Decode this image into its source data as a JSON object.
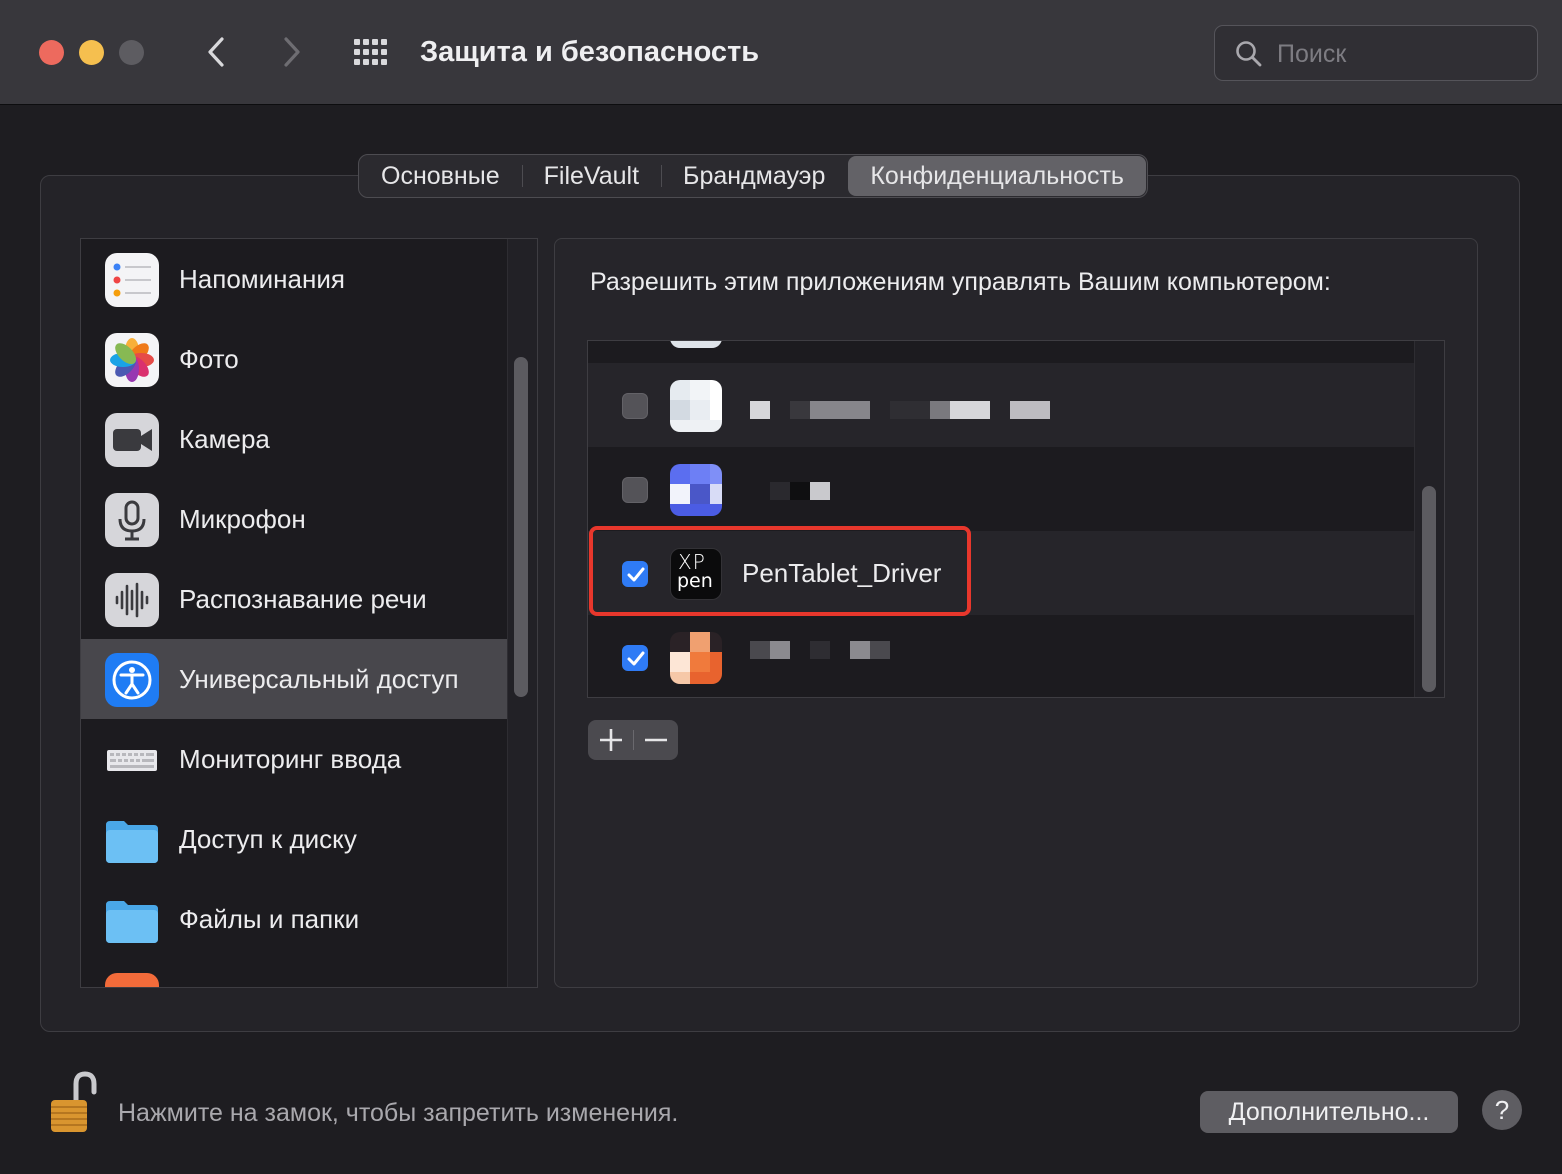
{
  "window": {
    "title": "Защита и безопасность",
    "search_placeholder": "Поиск"
  },
  "tabs": [
    {
      "label": "Основные",
      "active": false
    },
    {
      "label": "FileVault",
      "active": false
    },
    {
      "label": "Брандмауэр",
      "active": false
    },
    {
      "label": "Конфиденциальность",
      "active": true
    }
  ],
  "sidebar": {
    "items": [
      {
        "label": "Напоминания",
        "icon": "reminders-icon"
      },
      {
        "label": "Фото",
        "icon": "photos-icon"
      },
      {
        "label": "Камера",
        "icon": "camera-icon"
      },
      {
        "label": "Микрофон",
        "icon": "microphone-icon"
      },
      {
        "label": "Распознавание речи",
        "icon": "speech-recognition-icon"
      },
      {
        "label": "Универсальный доступ",
        "icon": "accessibility-icon",
        "selected": true
      },
      {
        "label": "Мониторинг ввода",
        "icon": "keyboard-icon"
      },
      {
        "label": "Доступ к диску",
        "icon": "folder-icon"
      },
      {
        "label": "Файлы и папки",
        "icon": "folder-icon"
      }
    ]
  },
  "panel": {
    "heading": "Разрешить этим приложениям управлять Вашим компьютером:",
    "apps": [
      {
        "name": "",
        "checked": false,
        "blurred": true
      },
      {
        "name": "",
        "checked": false,
        "blurred": true
      },
      {
        "name": "PenTablet_Driver",
        "checked": true,
        "blurred": false,
        "icon_text_top": "XP",
        "icon_text_bottom": "pen"
      },
      {
        "name": "",
        "checked": true,
        "blurred": true
      }
    ],
    "add_symbol": "+",
    "remove_symbol": "−"
  },
  "footer": {
    "lock_text": "Нажмите на замок, чтобы запретить изменения.",
    "advanced_label": "Дополнительно...",
    "help_label": "?"
  },
  "colors": {
    "accent": "#2f7bf5",
    "highlight": "#e8372c",
    "close": "#ed6a5e",
    "minimize": "#f5bf4f"
  }
}
